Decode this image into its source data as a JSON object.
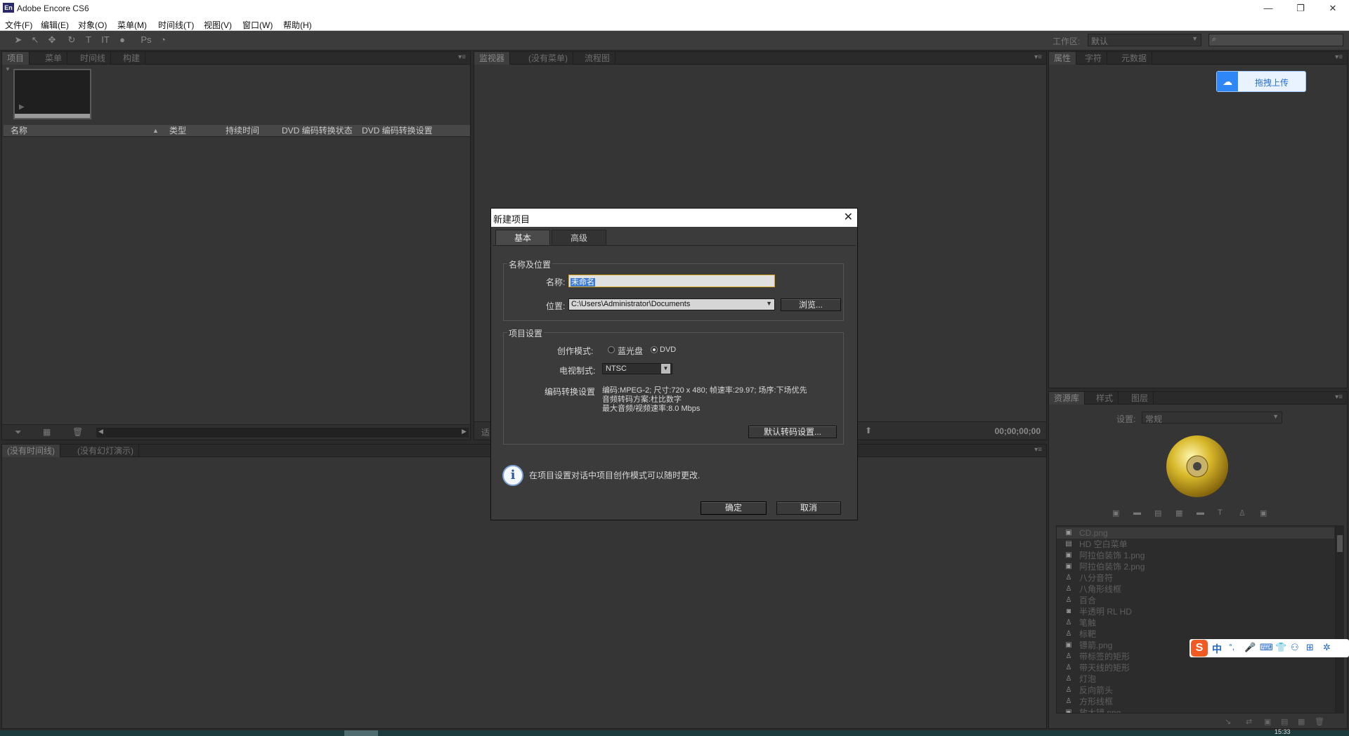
{
  "app": {
    "logo": "En",
    "title": "Adobe Encore CS6"
  },
  "window_controls": {
    "minimize": "—",
    "restore": "❐",
    "close": "✕"
  },
  "menu": [
    "文件(F)",
    "编辑(E)",
    "对象(O)",
    "菜单(M)",
    "时间线(T)",
    "视图(V)",
    "窗口(W)",
    "帮助(H)"
  ],
  "toolbar": {
    "workspace_label": "工作区:",
    "workspace_value": "默认"
  },
  "project_panel": {
    "tabs": [
      "项目",
      "菜单",
      "时间线",
      "构建"
    ],
    "columns": [
      "名称",
      "类型",
      "持续时间",
      "DVD 编码转换状态",
      "DVD 编码转换设置"
    ]
  },
  "monitor_panel": {
    "tabs": [
      "监视器",
      "(没有菜单)",
      "流程图"
    ],
    "timecode": "00;00;00;00",
    "small_label": "适"
  },
  "timeline_panel": {
    "tabs": [
      "(没有时间线)",
      "(没有幻灯演示)"
    ]
  },
  "properties_panel": {
    "tabs": [
      "属性",
      "字符",
      "元数据"
    ],
    "upload_button": "拖拽上传"
  },
  "library_panel": {
    "tabs": [
      "资源库",
      "样式",
      "图层"
    ],
    "set_label": "设置:",
    "set_value": "常规",
    "items": [
      {
        "icon": "image-icon",
        "label": "CD.png"
      },
      {
        "icon": "menu-icon",
        "label": "HD 空白菜单"
      },
      {
        "icon": "image-icon",
        "label": "阿拉伯装饰 1.png"
      },
      {
        "icon": "image-icon",
        "label": "阿拉伯装饰 2.png"
      },
      {
        "icon": "shape-icon",
        "label": "八分音符"
      },
      {
        "icon": "shape-icon",
        "label": "八角形线框"
      },
      {
        "icon": "shape-icon",
        "label": "百合"
      },
      {
        "icon": "overlay-icon",
        "label": "半透明 RL HD"
      },
      {
        "icon": "shape-icon",
        "label": "笔触"
      },
      {
        "icon": "shape-icon",
        "label": "标靶"
      },
      {
        "icon": "image-icon",
        "label": "镖箭.png"
      },
      {
        "icon": "shape-icon",
        "label": "带标签的矩形"
      },
      {
        "icon": "shape-icon",
        "label": "带天线的矩形"
      },
      {
        "icon": "shape-icon",
        "label": "灯泡"
      },
      {
        "icon": "shape-icon",
        "label": "反向箭头"
      },
      {
        "icon": "shape-icon",
        "label": "方形线框"
      },
      {
        "icon": "image-icon",
        "label": "放大镜.png"
      }
    ]
  },
  "dialog": {
    "title": "新建项目",
    "close": "✕",
    "tabs": [
      "基本",
      "高级"
    ],
    "group1": "名称及位置",
    "name_label": "名称:",
    "name_value": "未命名",
    "location_label": "位置:",
    "location_value": "C:\\Users\\Administrator\\Documents",
    "browse": "浏览...",
    "group2": "项目设置",
    "authoring_label": "创作模式:",
    "mode_bluray": "蓝光盘",
    "mode_dvd": "DVD",
    "tv_label": "电视制式:",
    "tv_value": "NTSC",
    "transcode_label": "编码转换设置",
    "transcode_line1": "编码:MPEG-2; 尺寸:720 x 480; 帧速率:29.97; 场序:下场优先",
    "transcode_line2": "音频转码方案:杜比数字",
    "transcode_line3": "最大音频/视频速率:8.0 Mbps",
    "default_transcode": "默认转码设置...",
    "info": "在项目设置对话中项目创作模式可以随时更改.",
    "ok": "确定",
    "cancel": "取消"
  },
  "ime": {
    "lang": "中",
    "punct": "°,"
  },
  "clock": "15:33"
}
